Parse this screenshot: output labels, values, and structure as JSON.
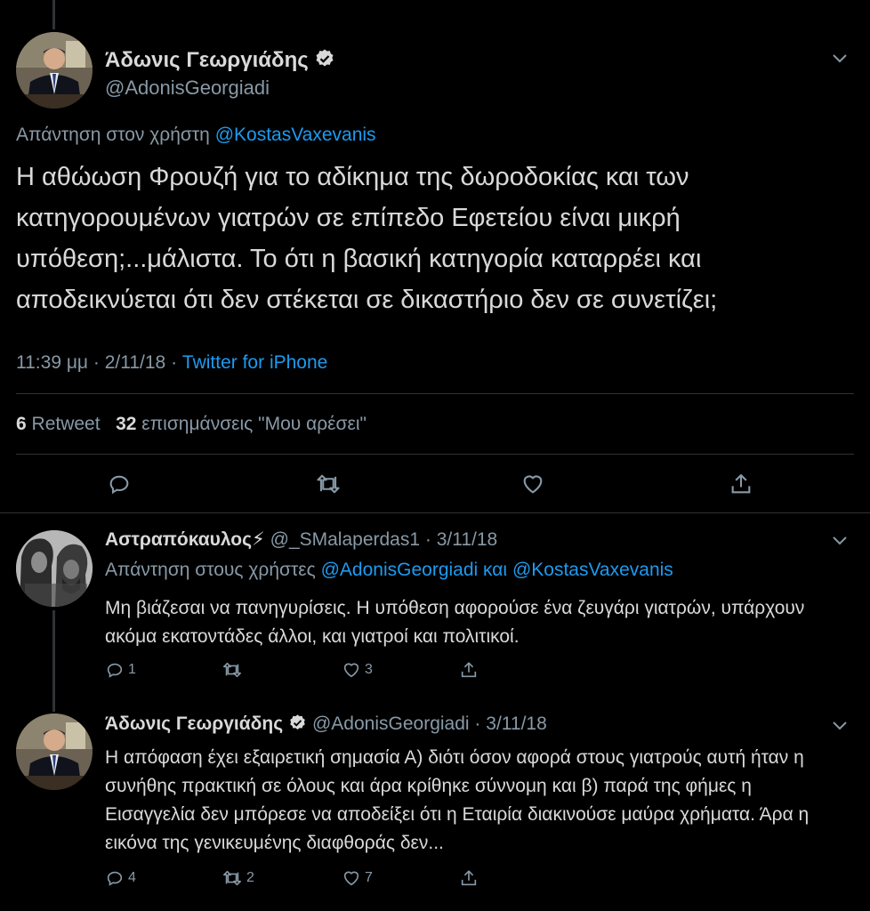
{
  "colors": {
    "background": "#000000",
    "text": "#d9d9d9",
    "muted": "#8899a6",
    "link": "#1d9bf0",
    "divider": "#2f3336"
  },
  "main_tweet": {
    "name": "Άδωνις Γεωργιάδης",
    "handle": "@AdonisGeorgiadi",
    "reply_prefix": "Απάντηση στον χρήστη",
    "reply_user": "@KostasVaxevanis",
    "text": "Η αθώωση Φρουζή για το αδίκημα της δωροδοκίας και των κατηγορουμένων γιατρών σε επίπεδο Εφετείου είναι μικρή υπόθεση;...μάλιστα. Το ότι η βασική κατηγορία καταρρέει και αποδεικνύεται ότι δεν στέκεται σε δικαστήριο δεν σε συνετίζει;",
    "time": "11:39 μμ",
    "date": "2/11/18",
    "source": "Twitter for iPhone",
    "retweet_count": "6",
    "retweet_label": "Retweet",
    "like_count": "32",
    "like_label": "επισημάνσεις \"Μου αρέσει\""
  },
  "replies": [
    {
      "name": "Αστραπόκαυλος⚡",
      "handle": "@_SMalaperdas1",
      "date": "3/11/18",
      "reply_prefix": "Απάντηση στους χρήστες",
      "reply_user1": "@AdonisGeorgiadi",
      "reply_and": "και",
      "reply_user2": "@KostasVaxevanis",
      "text": "Μη βιάζεσαι να πανηγυρίσεις. Η υπόθεση αφορούσε ένα ζευγάρι γιατρών, υπάρχουν ακόμα εκατοντάδες άλλοι, και γιατροί και πολιτικοί.",
      "reply_count": "1",
      "retweet_count": "",
      "like_count": "3"
    },
    {
      "name": "Άδωνις Γεωργιάδης",
      "handle": "@AdonisGeorgiadi",
      "date": "3/11/18",
      "text": "Η απόφαση έχει εξαιρετική σημασία Α) διότι όσον αφορά στους γιατρούς αυτή ήταν η συνήθης πρακτική σε όλους και άρα κρίθηκε σύννομη και β) παρά της φήμες η Εισαγγελία δεν μπόρεσε να αποδείξει ότι η Εταιρία διακινούσε μαύρα χρήματα. Άρα η εικόνα της γενικευμένης διαφθοράς δεν...",
      "reply_count": "4",
      "retweet_count": "2",
      "like_count": "7"
    }
  ],
  "separators": {
    "dot": "·"
  }
}
